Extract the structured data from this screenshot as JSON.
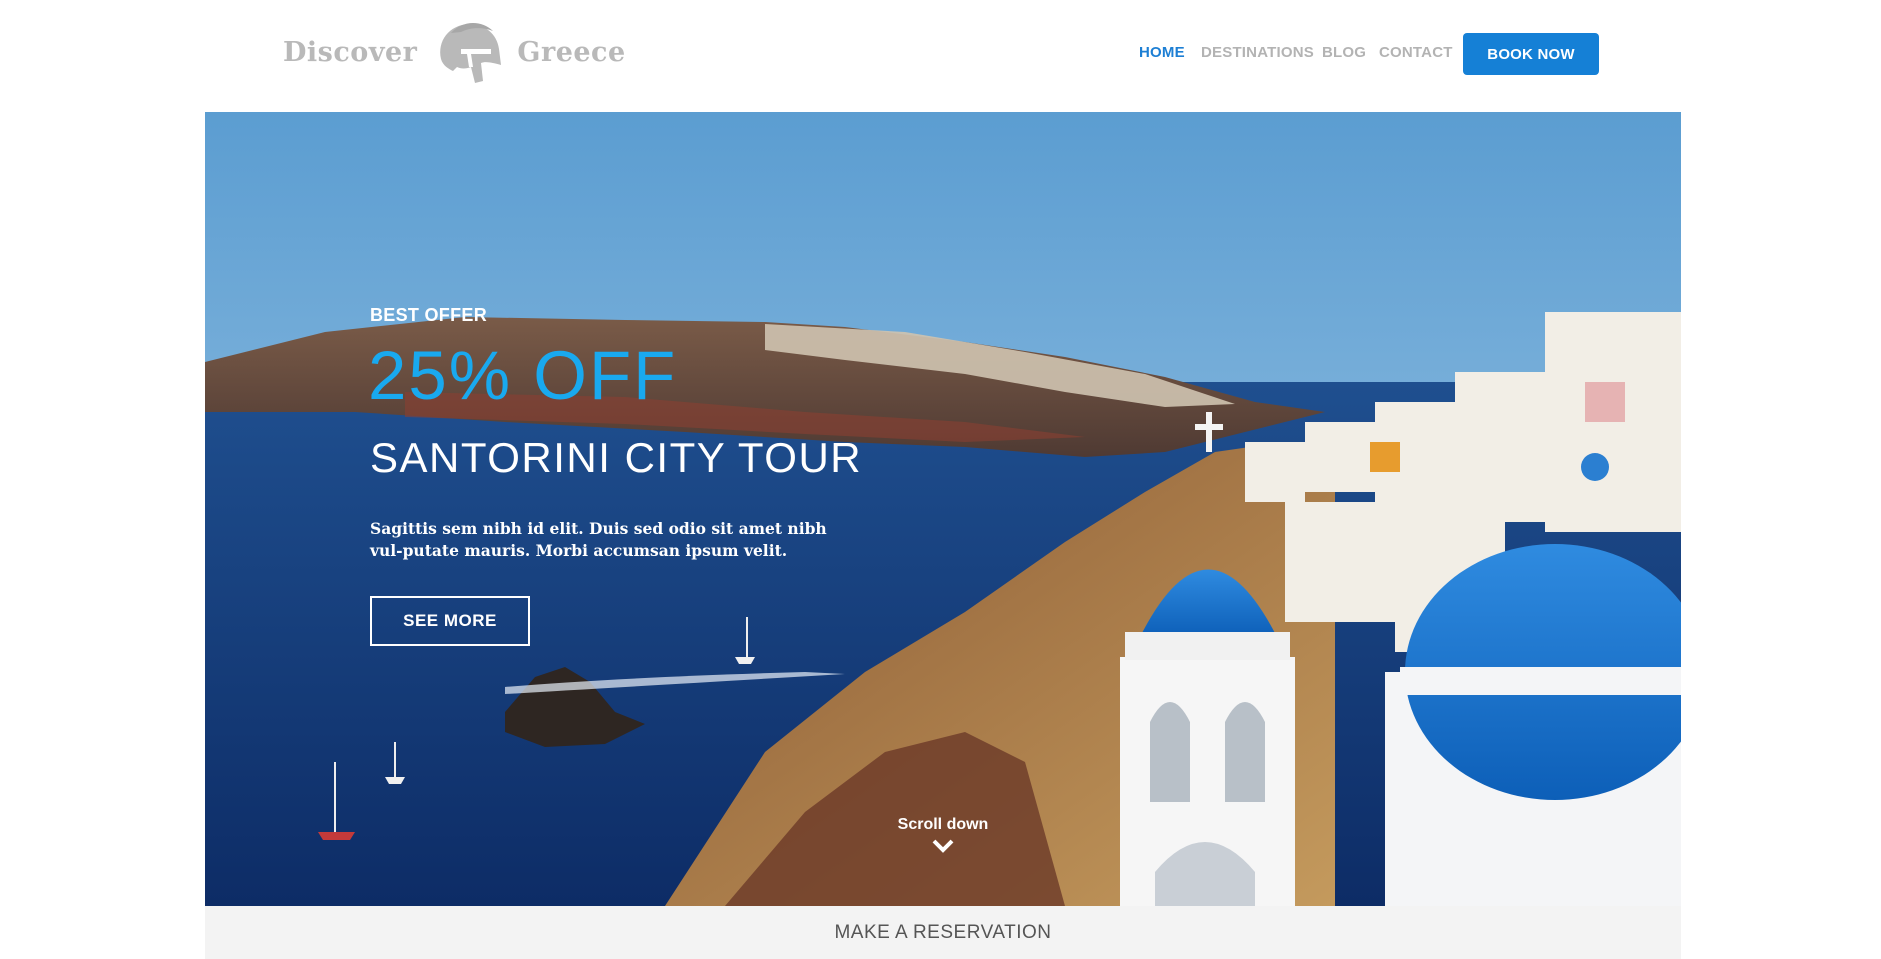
{
  "brand": {
    "word_left": "Discover",
    "word_right": "Greece",
    "logo_icon": "spartan-helmet-icon",
    "logo_color": "#b9b9b9"
  },
  "nav": {
    "items": [
      {
        "label": "HOME",
        "active": true
      },
      {
        "label": "DESTINATIONS",
        "active": false
      },
      {
        "label": "BLOG",
        "active": false
      },
      {
        "label": "CONTACT",
        "active": false
      }
    ],
    "book_label": "BOOK NOW"
  },
  "hero": {
    "eyebrow": "BEST OFFER",
    "discount": "25% OFF",
    "title": "SANTORINI CITY TOUR",
    "description": "Sagittis sem nibh id elit. Duis sed odio sit amet nibh vul-putate mauris. Morbi accumsan ipsum velit.",
    "cta_label": "SEE MORE",
    "scroll_label": "Scroll down",
    "scroll_icon": "chevron-down-icon"
  },
  "reservation": {
    "label": "MAKE A RESERVATION"
  },
  "colors": {
    "accent": "#1580d6",
    "nav_active": "#1d7fd4",
    "discount": "#19a9ef",
    "nav_inactive": "#b3b3b3",
    "reservation_bg": "#f3f3f3"
  }
}
